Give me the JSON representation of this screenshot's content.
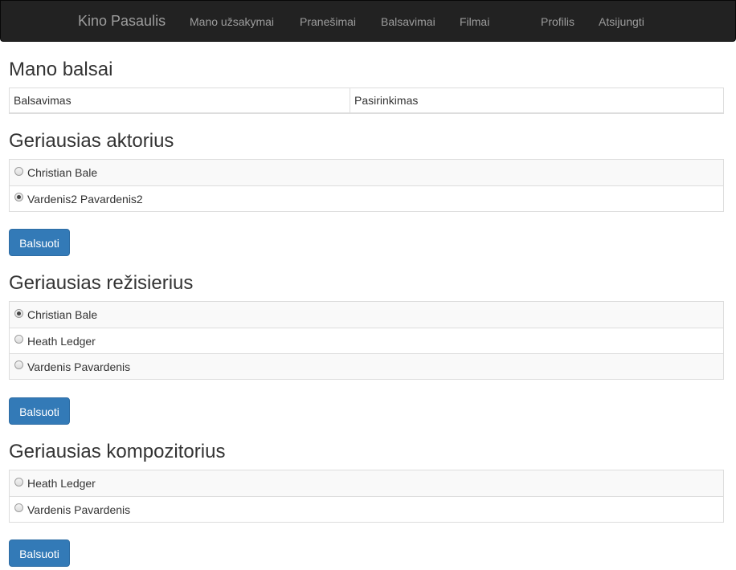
{
  "navbar": {
    "brand": "Kino Pasaulis",
    "links": [
      "Mano užsakymai",
      "Pranešimai",
      "Balsavimai",
      "Filmai",
      "Profilis",
      "Atsijungti"
    ]
  },
  "my_votes": {
    "title": "Mano balsai",
    "columns": [
      "Balsavimas",
      "Pasirinkimas"
    ]
  },
  "polls": [
    {
      "title": "Geriausias aktorius",
      "options": [
        {
          "label": "Christian Bale",
          "checked": false
        },
        {
          "label": "Vardenis2 Pavardenis2",
          "checked": true
        }
      ],
      "button": "Balsuoti"
    },
    {
      "title": "Geriausias režisierius",
      "options": [
        {
          "label": "Christian Bale",
          "checked": true
        },
        {
          "label": "Heath Ledger",
          "checked": false
        },
        {
          "label": "Vardenis Pavardenis",
          "checked": false
        }
      ],
      "button": "Balsuoti"
    },
    {
      "title": "Geriausias kompozitorius",
      "options": [
        {
          "label": "Heath Ledger",
          "checked": false
        },
        {
          "label": "Vardenis Pavardenis",
          "checked": false
        }
      ],
      "button": "Balsuoti"
    }
  ]
}
